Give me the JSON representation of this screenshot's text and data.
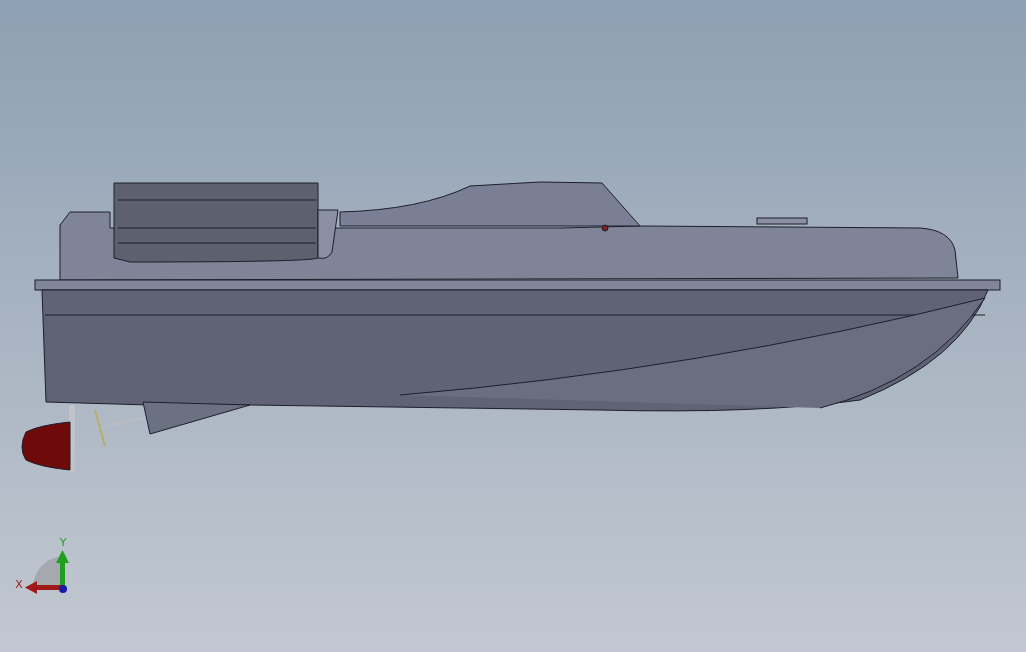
{
  "viewport": {
    "triad": {
      "axes": [
        {
          "kind": "vertical",
          "label": "Y",
          "color": "#1f9e1f"
        },
        {
          "kind": "horizontal",
          "label": "X",
          "color": "#a01818"
        }
      ]
    }
  }
}
